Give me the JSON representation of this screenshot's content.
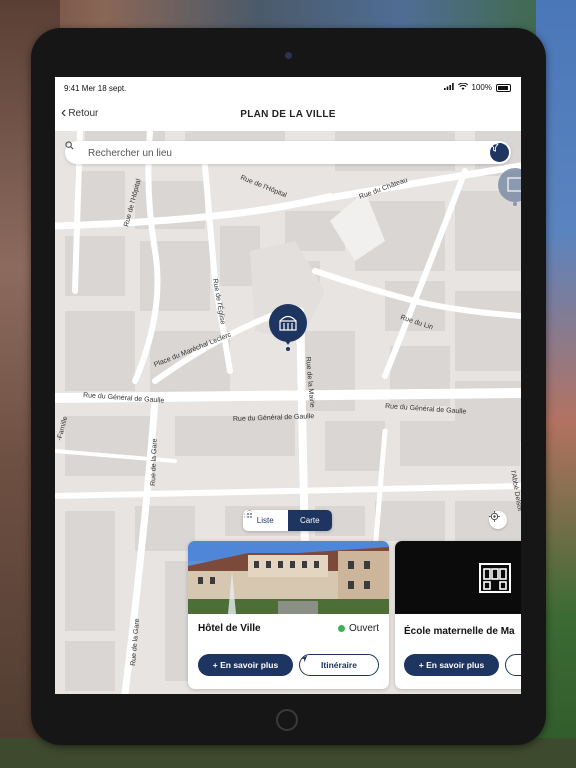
{
  "status_bar": {
    "time": "9:41 Mer 18 sept.",
    "battery": "100%"
  },
  "nav": {
    "back_label": "Retour",
    "title": "PLAN DE LA VILLE"
  },
  "search": {
    "placeholder": "Rechercher un lieu"
  },
  "streets": {
    "hopital": "Rue de l'Hôpital",
    "hopital2": "Rue de l'Hôpital",
    "chateau": "Rue du Château",
    "eglise": "Rue de l'Église",
    "leclerc": "Place du Maréchal Leclerc",
    "mairie": "Rue de la Mairie",
    "lin": "Rue du Lin",
    "degaulle_w": "Rue du Général de Gaulle",
    "degaulle_c": "Rue du Général de Gaulle",
    "degaulle_e": "Rue du Général de Gaulle",
    "famille": "-Famille",
    "gare1": "Rue de la Gare",
    "gare2": "Rue de la Gare",
    "delsor": "l'Abbé Delsor"
  },
  "view_toggle": {
    "list_label": "Liste",
    "map_label": "Carte",
    "active": "map"
  },
  "cards": [
    {
      "title": "Hôtel de Ville",
      "status": "Ouvert",
      "status_color": "#3fae57",
      "primary_label": "+ En savoir plus",
      "secondary_label": "Itinéraire"
    },
    {
      "title": "École maternelle de Ma",
      "primary_label": "+ En savoir plus"
    }
  ],
  "colors": {
    "accent": "#1d3560",
    "map_bg": "#e7e4e1",
    "block": "#d9d6d3"
  }
}
